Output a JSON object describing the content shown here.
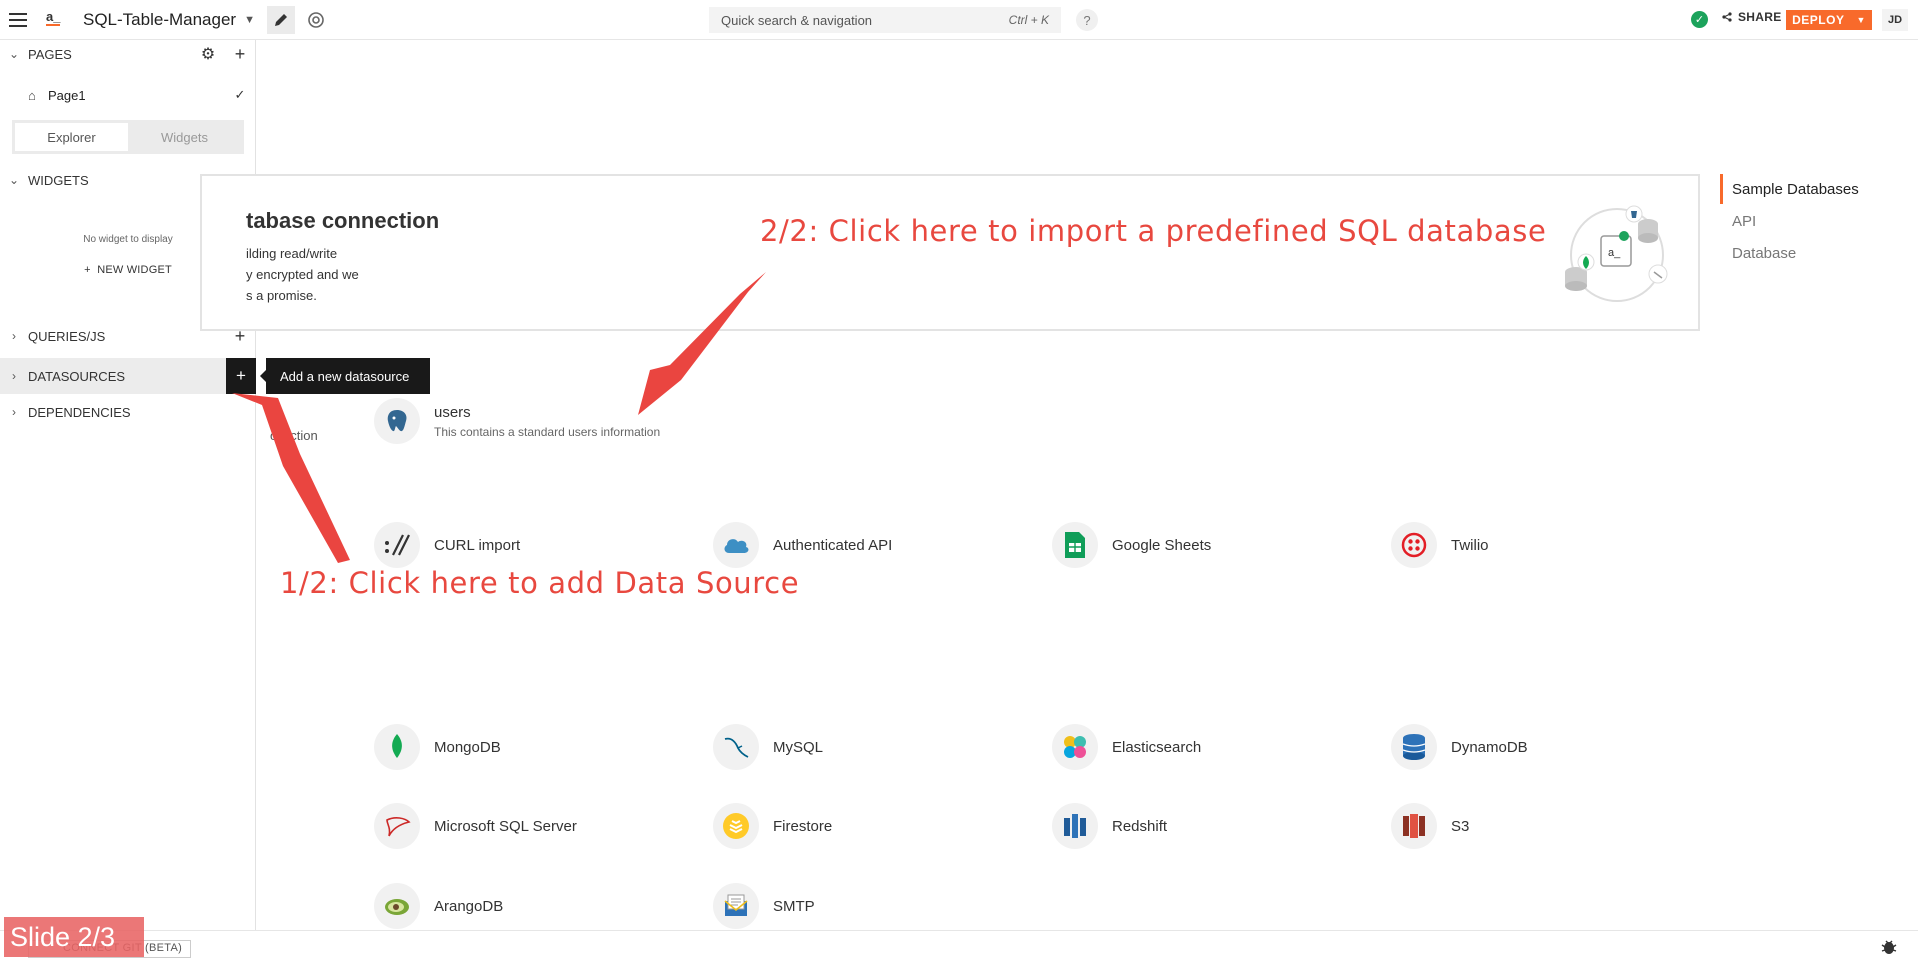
{
  "header": {
    "app_name": "SQL-Table-Manager",
    "logo": "a_",
    "search_placeholder": "Quick search & navigation",
    "search_shortcut": "Ctrl + K",
    "help": "?",
    "share_label": "SHARE",
    "deploy_label": "DEPLOY",
    "avatar": "JD"
  },
  "sidebar": {
    "pages_label": "PAGES",
    "page_name": "Page1",
    "tab_explorer": "Explorer",
    "tab_widgets": "Widgets",
    "widgets_label": "WIDGETS",
    "no_widget_text": "No widget to display",
    "new_widget_label": "NEW WIDGET",
    "queries_label": "QUERIES/JS",
    "datasources_label": "DATASOURCES",
    "dependencies_label": "DEPENDENCIES",
    "tooltip": "Add a new datasource"
  },
  "main": {
    "card_title": "tabase connection",
    "card_text": "ilding read/write\ny encrypted and we\ns a promise.",
    "left_fragment": "ollection",
    "right_nav": [
      "Sample Databases",
      "API",
      "Database"
    ],
    "sample": {
      "name": "users",
      "description": "This contains a standard users information"
    },
    "apis": [
      "CURL import",
      "Authenticated API",
      "Google Sheets",
      "Twilio"
    ],
    "databases": [
      "MongoDB",
      "MySQL",
      "Elasticsearch",
      "DynamoDB",
      "Microsoft SQL Server",
      "Firestore",
      "Redshift",
      "S3",
      "ArangoDB",
      "SMTP"
    ]
  },
  "annotations": {
    "step1": "1/2: Click here to add Data Source",
    "step2": "2/2: Click here to import a predefined SQL database"
  },
  "footer": {
    "connect_git": "CONNECT GIT (BETA)",
    "slide": "Slide 2/3"
  },
  "colors": {
    "accent": "#f86a2b",
    "annotation": "#e8483f",
    "success": "#1ca35c",
    "tooltip_bg": "#191919"
  }
}
